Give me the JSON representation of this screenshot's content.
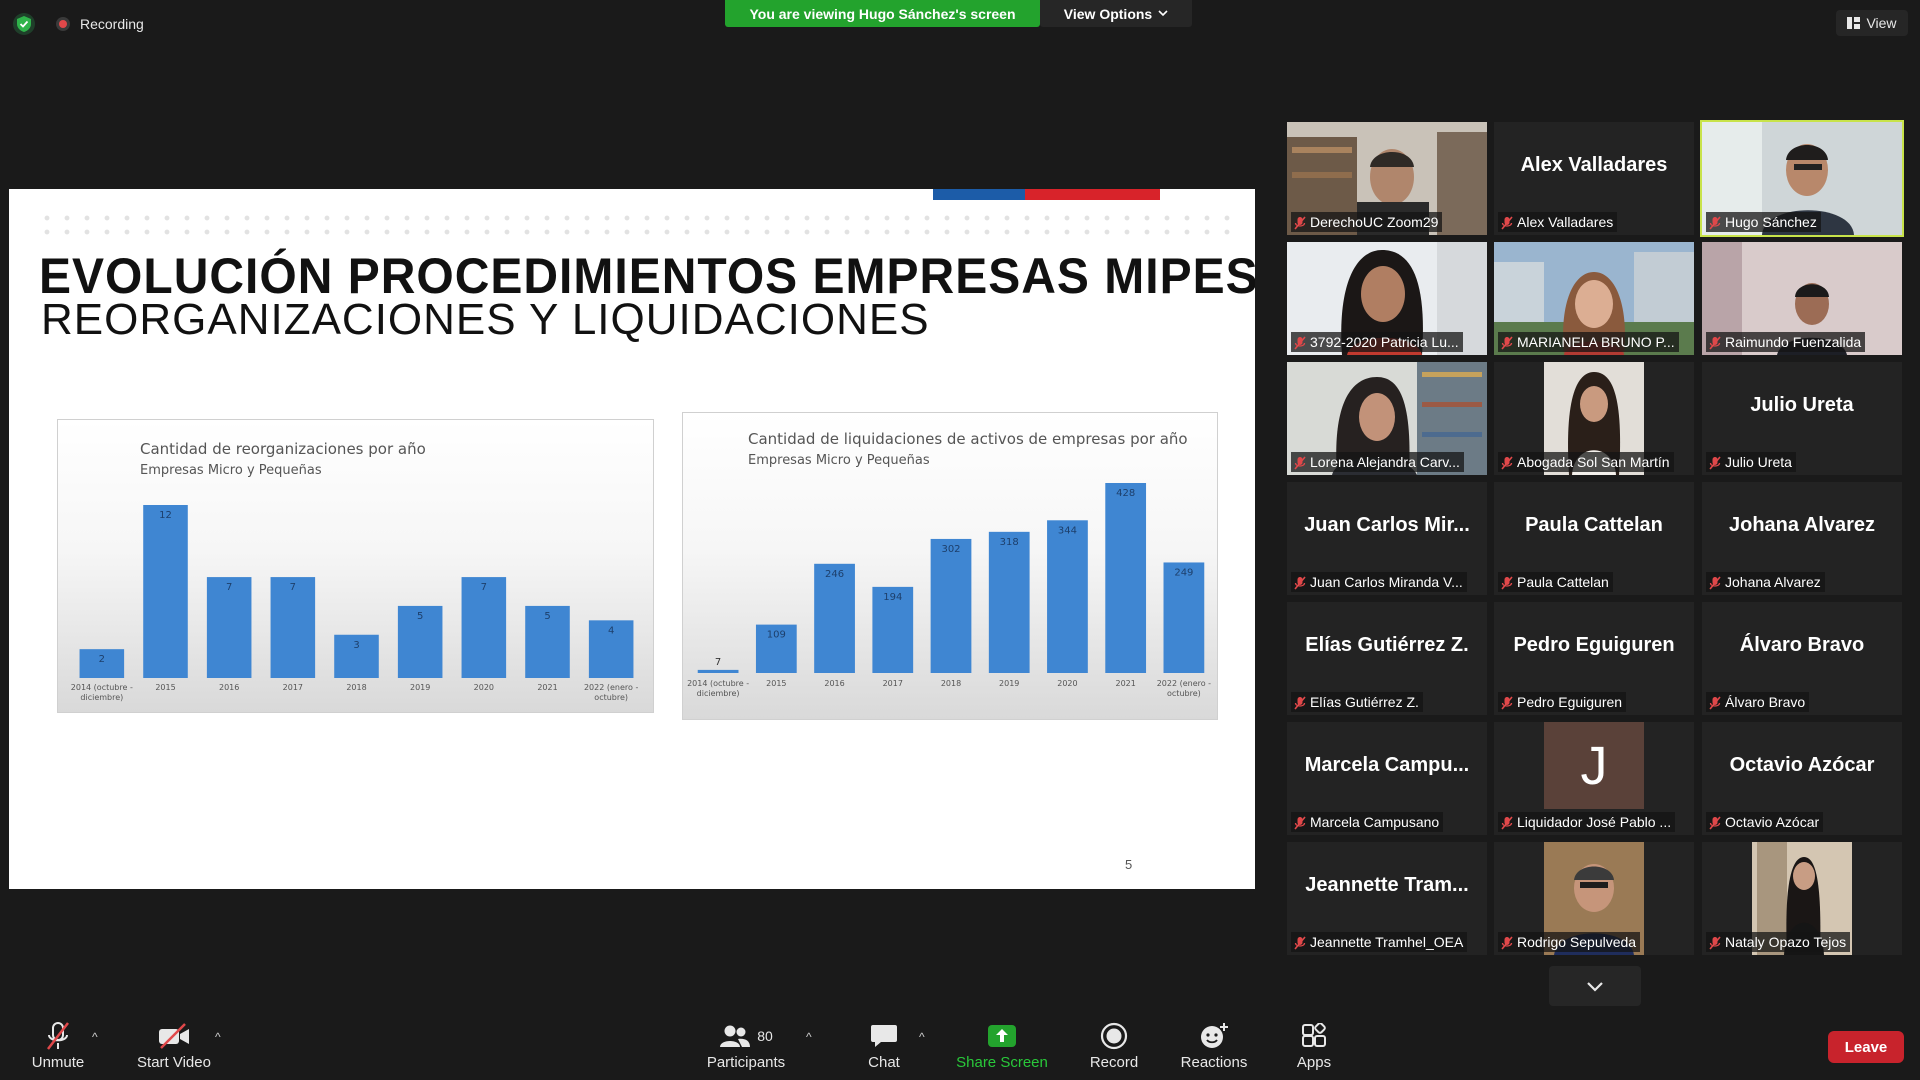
{
  "topbar": {
    "recording_label": "Recording",
    "viewing_banner": "You are viewing Hugo Sánchez's screen",
    "view_options_label": "View Options",
    "view_label": "View"
  },
  "slide": {
    "title": "EVOLUCIÓN PROCEDIMIENTOS EMPRESAS MIPES",
    "subtitle": "REORGANIZACIONES Y LIQUIDACIONES",
    "page_number": "5"
  },
  "chart_data": [
    {
      "type": "bar",
      "title": "Cantidad de reorganizaciones por año",
      "subtitle": "Empresas Micro y Pequeñas",
      "categories": [
        "2014 (octubre - diciembre)",
        "2015",
        "2016",
        "2017",
        "2018",
        "2019",
        "2020",
        "2021",
        "2022 (enero - octubre)"
      ],
      "values": [
        2,
        12,
        7,
        7,
        3,
        5,
        7,
        5,
        4
      ],
      "color": "#3f86d2"
    },
    {
      "type": "bar",
      "title": "Cantidad de liquidaciones de activos de empresas por año",
      "subtitle": "Empresas Micro y Pequeñas",
      "categories": [
        "2014 (octubre - diciembre)",
        "2015",
        "2016",
        "2017",
        "2018",
        "2019",
        "2020",
        "2021",
        "2022 (enero - octubre)"
      ],
      "values": [
        7,
        109,
        246,
        194,
        302,
        318,
        344,
        428,
        249
      ],
      "color": "#3f86d2"
    }
  ],
  "gallery": [
    {
      "label": "DerechoUC Zoom29",
      "display": "",
      "photo": "man-headset"
    },
    {
      "label": "Alex Valladares",
      "display": "Alex Valladares",
      "photo": ""
    },
    {
      "label": "Hugo Sánchez",
      "display": "",
      "photo": "man-speaker",
      "active": true
    },
    {
      "label": "3792-2020 Patricia Lu...",
      "display": "",
      "photo": "woman-dark-hair"
    },
    {
      "label": "MARIANELA BRUNO P...",
      "display": "",
      "photo": "woman-buildings"
    },
    {
      "label": "Raimundo Fuenzalida",
      "display": "",
      "photo": "man-room"
    },
    {
      "label": "Lorena Alejandra Carv...",
      "display": "",
      "photo": "woman-bookshelf"
    },
    {
      "label": "Abogada Sol San Martín",
      "display": "",
      "photo": "woman-portrait"
    },
    {
      "label": "Julio Ureta",
      "display": "Julio Ureta",
      "photo": ""
    },
    {
      "label": "Juan Carlos Miranda V...",
      "display": "Juan Carlos Mir...",
      "photo": ""
    },
    {
      "label": "Paula Cattelan",
      "display": "Paula Cattelan",
      "photo": ""
    },
    {
      "label": "Johana Alvarez",
      "display": "Johana Alvarez",
      "photo": ""
    },
    {
      "label": "Elías Gutiérrez Z.",
      "display": "Elías Gutiérrez Z.",
      "photo": ""
    },
    {
      "label": "Pedro Eguiguren",
      "display": "Pedro Eguiguren",
      "photo": ""
    },
    {
      "label": "Álvaro Bravo",
      "display": "Álvaro Bravo",
      "photo": ""
    },
    {
      "label": "Marcela Campusano",
      "display": "Marcela Campu...",
      "photo": ""
    },
    {
      "label": "Liquidador José Pablo ...",
      "display": "",
      "photo": "letter-avatar",
      "initial": "J"
    },
    {
      "label": "Octavio Azócar",
      "display": "Octavio Azócar",
      "photo": ""
    },
    {
      "label": "Jeannette Tramhel_OEA",
      "display": "Jeannette Tram...",
      "photo": ""
    },
    {
      "label": "Rodrigo Sepulveda",
      "display": "",
      "photo": "man-portrait"
    },
    {
      "label": "Nataly Opazo Tejos",
      "display": "",
      "photo": "woman-standing"
    }
  ],
  "toolbar": {
    "unmute_label": "Unmute",
    "start_video_label": "Start Video",
    "participants_label": "Participants",
    "participants_count": "80",
    "chat_label": "Chat",
    "share_screen_label": "Share Screen",
    "record_label": "Record",
    "reactions_label": "Reactions",
    "apps_label": "Apps",
    "leave_label": "Leave"
  },
  "colors": {
    "accent_green": "#23a32d",
    "active_speaker_border": "#c8e34a",
    "leave_red": "#c8232c",
    "bar_blue": "#3f86d2"
  }
}
